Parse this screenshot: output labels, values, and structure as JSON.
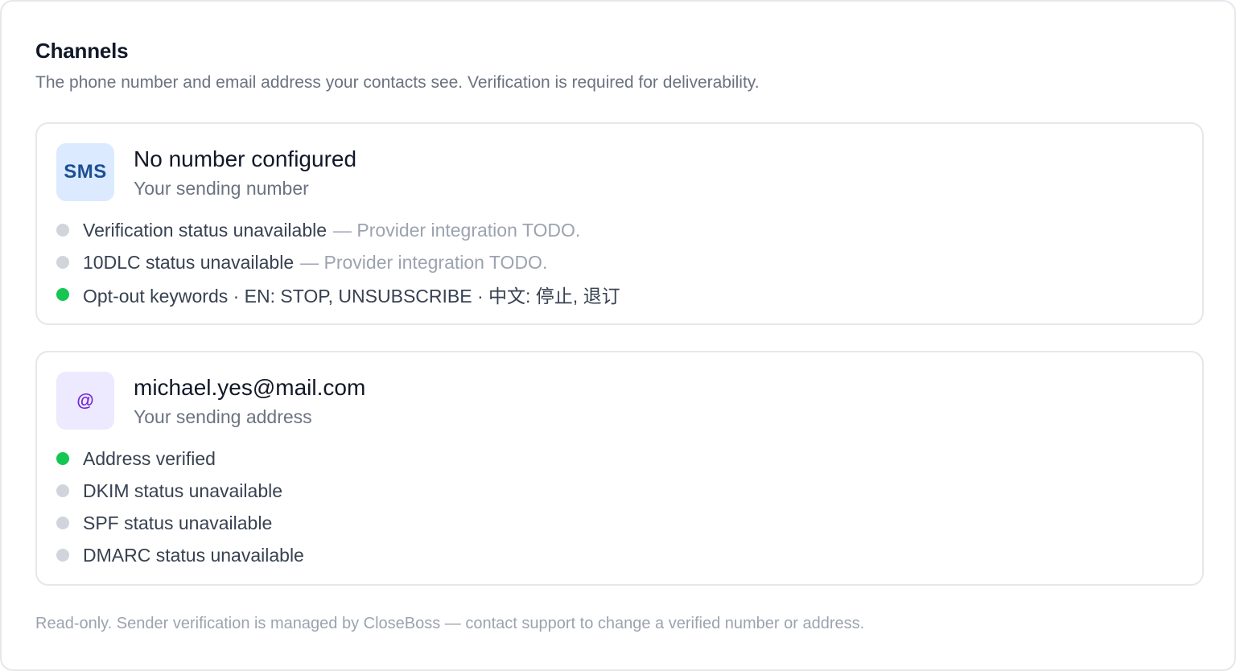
{
  "header": {
    "title": "Channels",
    "subtitle": "The phone number and email address your contacts see. Verification is required for deliverability."
  },
  "sms": {
    "badge": "SMS",
    "title": "No number configured",
    "subtitle": "Your sending number",
    "statuses": [
      {
        "label": "Verification status unavailable",
        "note": "— Provider integration TODO.",
        "state": "grey"
      },
      {
        "label": "10DLC status unavailable",
        "note": "— Provider integration TODO.",
        "state": "grey"
      },
      {
        "label": "Opt-out keywords · EN: STOP, UNSUBSCRIBE · 中文: 停止, 退订",
        "note": "",
        "state": "green"
      }
    ]
  },
  "email": {
    "badge": "@",
    "title": "michael.yes@mail.com",
    "subtitle": "Your sending address",
    "statuses": [
      {
        "label": "Address verified",
        "state": "green"
      },
      {
        "label": "DKIM status unavailable",
        "state": "grey"
      },
      {
        "label": "SPF status unavailable",
        "state": "grey"
      },
      {
        "label": "DMARC status unavailable",
        "state": "grey"
      }
    ]
  },
  "footer": {
    "text": "Read-only. Sender verification is managed by CloseBoss — contact support to change a verified number or address."
  },
  "colors": {
    "status_green": "#16c653",
    "status_grey": "#d1d5db",
    "sms_badge_bg": "#dbeafe",
    "email_badge_bg": "#ede9fe"
  }
}
